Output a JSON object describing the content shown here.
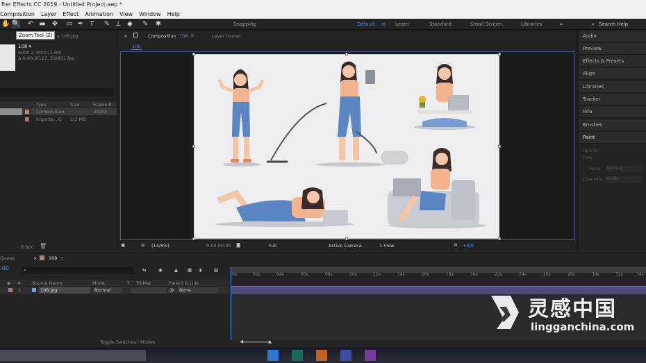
{
  "app": {
    "title": "fter Effects CC 2019 - Untitled Project.aep *"
  },
  "menu": [
    "Composition",
    "Layer",
    "Effect",
    "Animation",
    "View",
    "Window",
    "Help"
  ],
  "toolbar": {
    "snapping": "Snapping",
    "workspaces": [
      "Default",
      "Learn",
      "Standard",
      "Small Screen",
      "Libraries"
    ],
    "search_placeholder": "Search Help"
  },
  "tooltip": "Zoom Tool (Z)",
  "project": {
    "tab": "x 108.jpg",
    "item_name": "108 ▾",
    "item_info1": "6000 x 4000 (1.00)",
    "item_info2": "Δ 0:00:35:27, 29/831 fps",
    "columns": [
      "Type",
      "Size",
      "Frame R..."
    ],
    "rows": [
      {
        "type": "Composition",
        "size": "",
        "fr": "29/83"
      },
      {
        "type": "Importe...G",
        "size": "1/3 MB",
        "fr": ""
      }
    ],
    "footer": "8 bpc"
  },
  "comp": {
    "tab_label": "Composition",
    "tab_name": "108",
    "layer_label": "Layer (none)",
    "breadcrumb": "108",
    "footer": {
      "zoom": "(13/8%)",
      "time": "0:00:00:00",
      "res": "Full",
      "camera": "Active Camera",
      "views": "1 View",
      "offset": "+0/0"
    }
  },
  "rightpanel": {
    "items": [
      "Audio",
      "Preview",
      "Effects & Presets",
      "Align",
      "Libraries",
      "Tracker",
      "Info",
      "Brushes",
      "Paint"
    ],
    "paint": {
      "opacity": "Opacity",
      "flow": "Flow",
      "mode": "Mode",
      "mode_val": "Normal",
      "channels": "Channels",
      "channels_val": "RGBA"
    }
  },
  "timeline": {
    "queue": "Queue",
    "tab": "108",
    "time": ":00",
    "search_icon": "search-icon",
    "columns": {
      "source": "Source Name",
      "mode": "Mode",
      "t": "T",
      "trkmat": "TrkMat",
      "parent": "Parent & Link"
    },
    "layer": {
      "num": "1",
      "name": "108.jpg",
      "mode": "Normal",
      "parent": "None"
    },
    "ticks": [
      "0s",
      "02s",
      "04s",
      "06s",
      "08s",
      "10s",
      "12s",
      "14s",
      "16s",
      "18s",
      "20s",
      "22s",
      "24s",
      "26s",
      "28s",
      "30s",
      "32s",
      "34s"
    ],
    "toggle": "Toggle Switches / Modes"
  },
  "watermark": {
    "cn": "灵感中国",
    "url": "lingganchina.com"
  }
}
